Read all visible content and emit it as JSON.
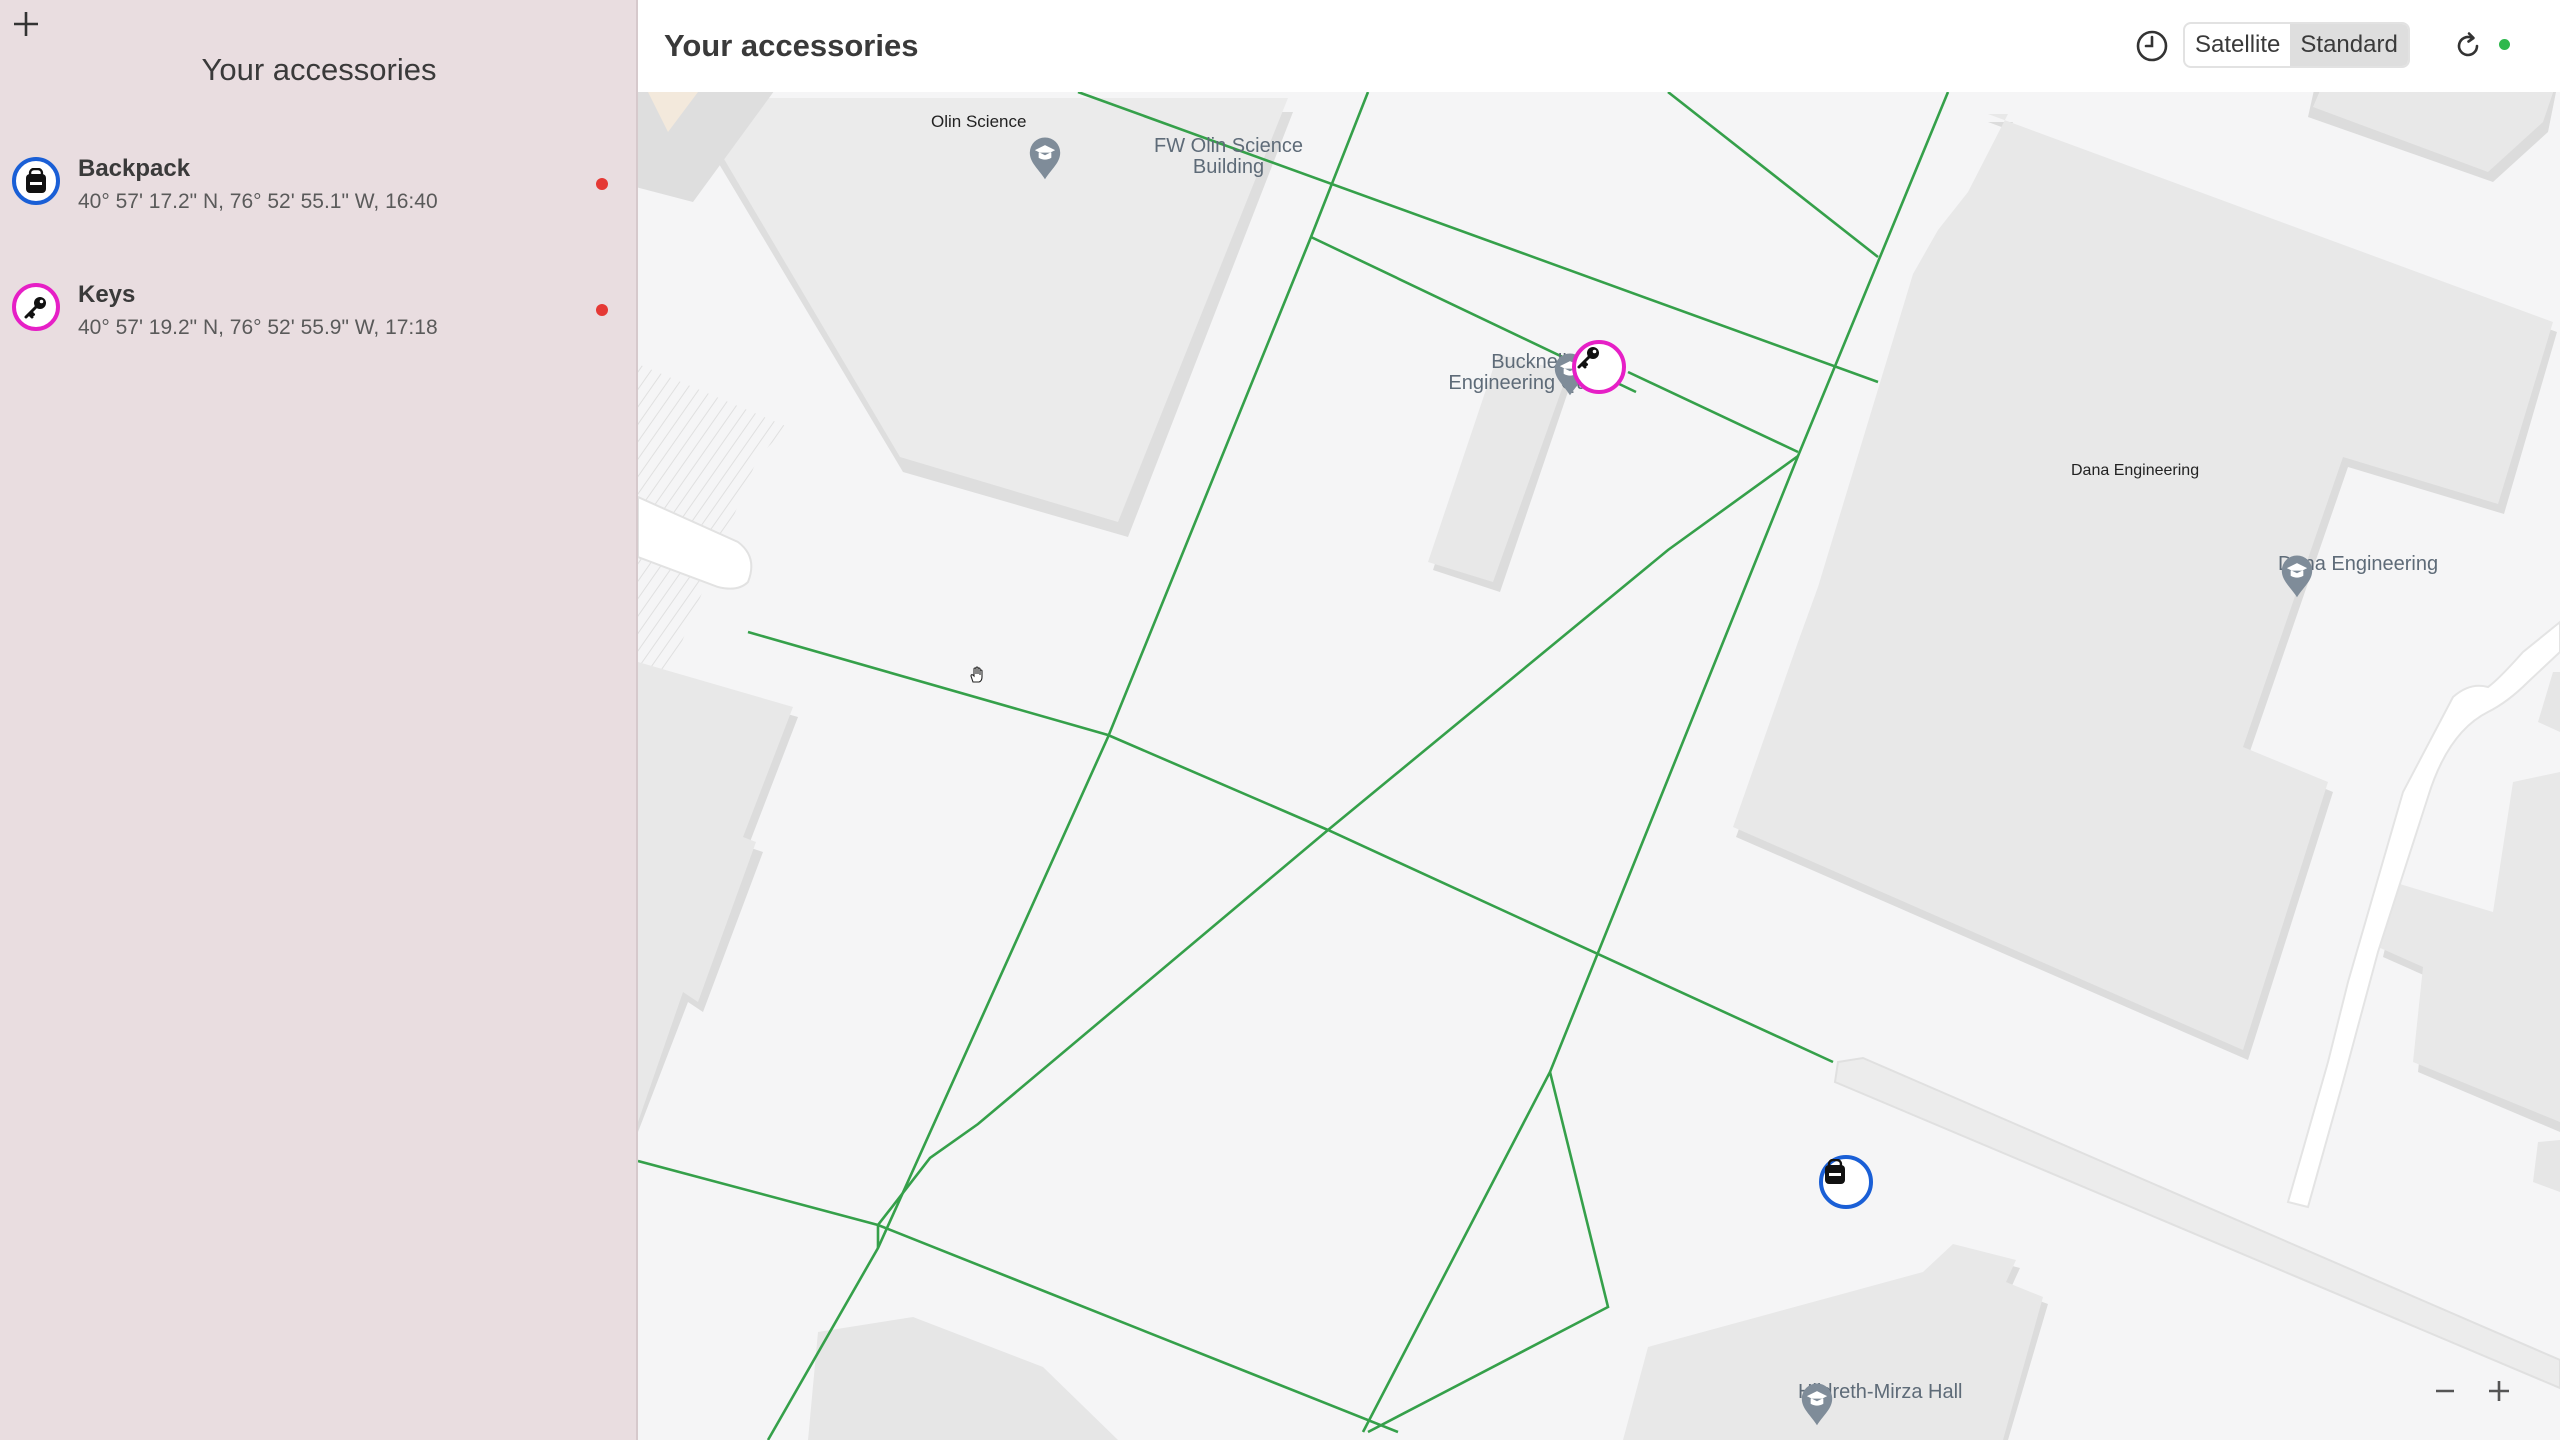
{
  "sidebar": {
    "title": "Your accessories",
    "add_icon": "plus-icon",
    "items": [
      {
        "name": "Backpack",
        "detail": "40° 57' 17.2\" N, 76° 52' 55.1\" W, 16:40",
        "icon": "backpack-icon",
        "ring_color": "#1a5fd6",
        "status_color": "#e53935"
      },
      {
        "name": "Keys",
        "detail": "40° 57' 19.2\" N, 76° 52' 55.9\" W, 17:18",
        "icon": "key-icon",
        "ring_color": "#e61fc6",
        "status_color": "#e53935"
      }
    ]
  },
  "header": {
    "title": "Your accessories",
    "history_icon": "clock-icon",
    "map_types": [
      "Satellite",
      "Standard"
    ],
    "selected_map_type": "Standard",
    "refresh_icon": "refresh-icon",
    "status_color": "#2db84c"
  },
  "map": {
    "labels": {
      "olin_science": "Olin Science",
      "olin_poi": "FW Olin Science Building",
      "quad_poi": "Bucknell Engineering Quad",
      "dana_building": "Dana Engineering",
      "dana_poi": "Dana Engineering",
      "hildreth_poi": "Hildreth-Mirza Hall"
    },
    "path_color": "#35a04a",
    "zoom_out_icon": "minus-icon",
    "zoom_in_icon": "plus-icon"
  }
}
